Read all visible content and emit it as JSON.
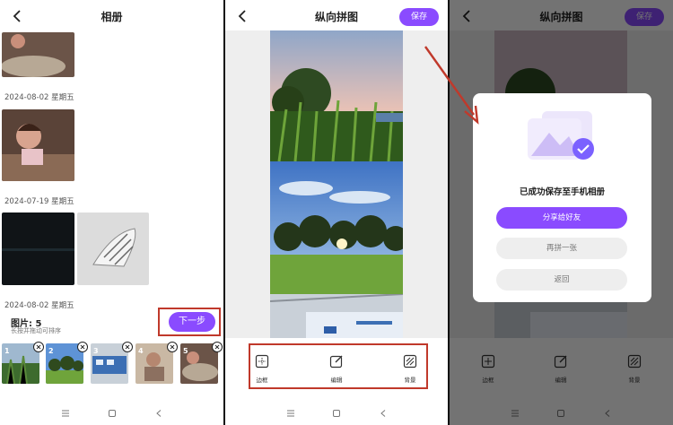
{
  "colors": {
    "accent": "#8a4bff",
    "highlight_box": "#c0392b",
    "divider": "#111111"
  },
  "album": {
    "title": "相册",
    "dates": [
      "2024-08-02 星期五",
      "2024-07-19 星期五",
      "2024-08-02 星期五"
    ],
    "selected_count_label": "图片: 5",
    "hint": "长按并拖动可排序",
    "next_button": "下一步",
    "strip": [
      "1",
      "2",
      "3",
      "4",
      "5"
    ]
  },
  "editor": {
    "title": "纵向拼图",
    "save_button": "保存",
    "tools": [
      {
        "label": "边框",
        "icon": "border-icon"
      },
      {
        "label": "编辑",
        "icon": "edit-icon"
      },
      {
        "label": "背景",
        "icon": "background-icon"
      }
    ]
  },
  "dialog": {
    "message": "已成功保存至手机相册",
    "share_button": "分享给好友",
    "again_button": "再拼一张",
    "return_button": "返回"
  }
}
